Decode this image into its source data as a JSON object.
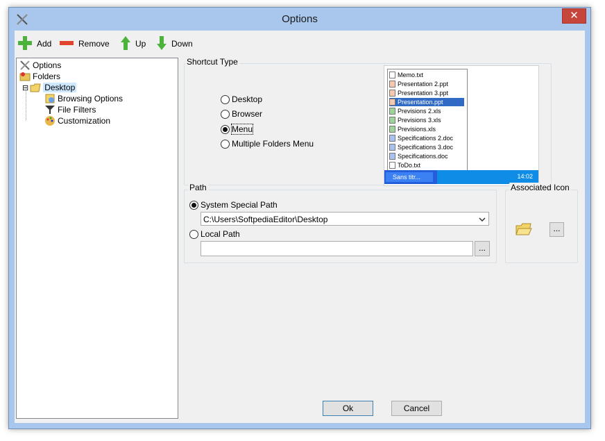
{
  "window": {
    "title": "Options",
    "close_label": "✕"
  },
  "toolbar": {
    "add_label": "Add",
    "remove_label": "Remove",
    "up_label": "Up",
    "down_label": "Down"
  },
  "tree": {
    "items": [
      {
        "label": "Options",
        "icon": "tools-icon"
      },
      {
        "label": "Folders",
        "icon": "folders-icon"
      },
      {
        "label": "Desktop",
        "icon": "desktop-folder-icon",
        "expander": "⊟"
      },
      {
        "label": "Browsing Options",
        "icon": "browsing-icon"
      },
      {
        "label": "File Filters",
        "icon": "filter-icon"
      },
      {
        "label": "Customization",
        "icon": "palette-icon"
      }
    ]
  },
  "shortcut_type": {
    "label": "Shortcut Type",
    "options": [
      {
        "label": "Desktop",
        "checked": false
      },
      {
        "label": "Browser",
        "checked": false
      },
      {
        "label": "Menu",
        "checked": true
      },
      {
        "label": "Multiple Folders Menu",
        "checked": false
      }
    ]
  },
  "preview": {
    "menu_items": [
      "Memo.txt",
      "Presentation 2.ppt",
      "Presentation 3.ppt",
      "Presentation.ppt",
      "Previsions 2.xls",
      "Previsions 3.xls",
      "Previsions.xls",
      "Specifications 2.doc",
      "Specifications 3.doc",
      "Specifications.doc",
      "ToDo.txt"
    ],
    "highlighted_index": 3,
    "task_button": "Sans titr...",
    "clock": "14:02"
  },
  "path": {
    "label": "Path",
    "system_label": "System Special Path",
    "system_checked": true,
    "system_value": "C:\\Users\\SoftpediaEditor\\Desktop",
    "local_label": "Local Path",
    "local_checked": false,
    "local_value": "",
    "browse_label": "..."
  },
  "assoc_icon": {
    "label": "Associated Icon",
    "browse_label": "..."
  },
  "footer": {
    "ok_label": "Ok",
    "cancel_label": "Cancel"
  },
  "colors": {
    "titlebar": "#a9c7ec",
    "close": "#c7463b",
    "selection": "#316ac5"
  }
}
